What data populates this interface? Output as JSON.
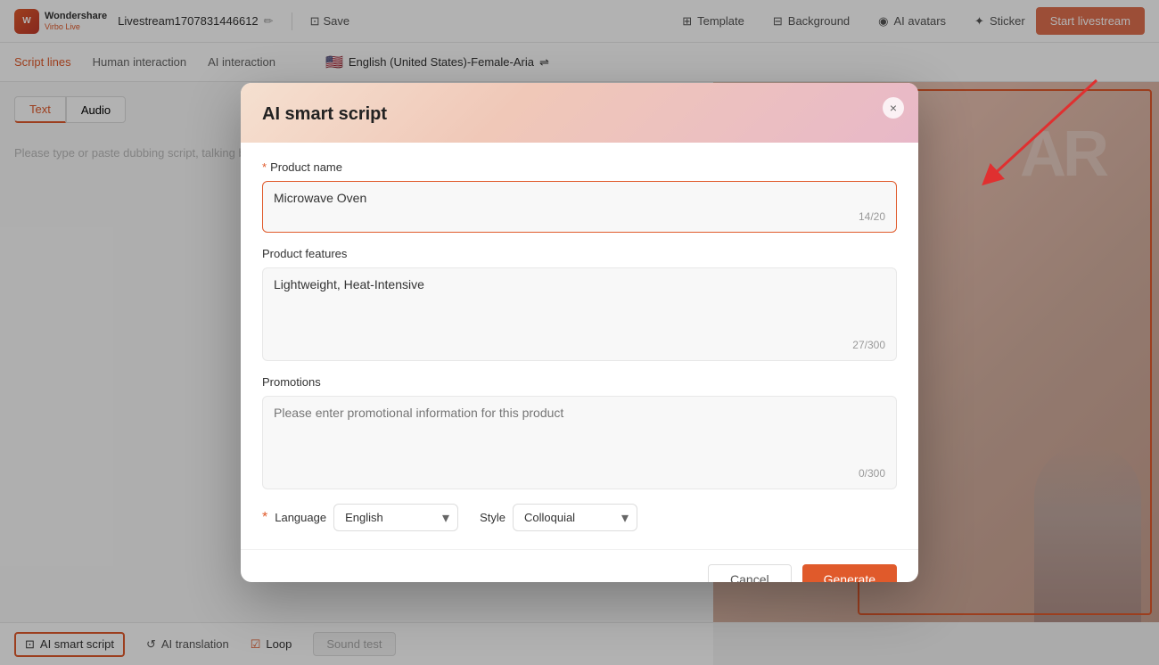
{
  "app": {
    "logo_text": "Wondershare",
    "logo_subtext": "Virbo Live",
    "project_name": "Livestream1707831446612",
    "save_label": "Save",
    "nav_items": [
      {
        "id": "template",
        "label": "Template",
        "icon": "template-icon"
      },
      {
        "id": "background",
        "label": "Background",
        "icon": "background-icon"
      },
      {
        "id": "ai-avatars",
        "label": "AI avatars",
        "icon": "avatar-icon"
      },
      {
        "id": "sticker",
        "label": "Sticker",
        "icon": "sticker-icon"
      }
    ],
    "start_btn_label": "Start livestream"
  },
  "second_bar": {
    "tabs": [
      {
        "id": "script-lines",
        "label": "Script lines",
        "active": true
      },
      {
        "id": "human-interaction",
        "label": "Human interaction",
        "active": false
      },
      {
        "id": "ai-interaction",
        "label": "AI interaction",
        "active": false
      }
    ],
    "language_selector": "English (United States)-Female-Aria"
  },
  "left_panel": {
    "text_tab_label": "Text",
    "audio_tab_label": "Audio",
    "script_placeholder": "Please type or paste dubbing script, talking breaks."
  },
  "bottom_bar": {
    "ai_smart_script_label": "AI smart script",
    "ai_translation_label": "AI translation",
    "loop_label": "Loop",
    "sound_test_label": "Sound test"
  },
  "modal": {
    "title": "AI smart script",
    "close_label": "×",
    "product_name_label": "Product name",
    "product_name_required": true,
    "product_name_value": "Microwave Oven",
    "product_name_char_count": "14/20",
    "product_features_label": "Product features",
    "product_features_value": "Lightweight, Heat-Intensive",
    "product_features_char_count": "27/300",
    "promotions_label": "Promotions",
    "promotions_placeholder": "Please enter promotional information for this product",
    "promotions_char_count": "0/300",
    "language_label": "Language",
    "language_value": "English",
    "style_label": "Style",
    "style_value": "Colloquial",
    "cancel_label": "Cancel",
    "generate_label": "Generate"
  }
}
